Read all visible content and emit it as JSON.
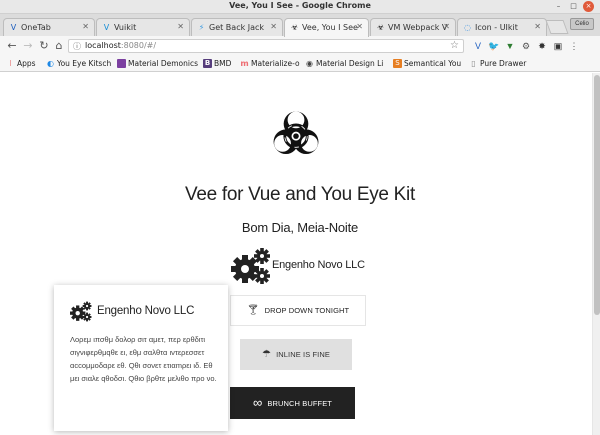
{
  "window": {
    "title": "Vee, You I See - Google Chrome",
    "controls": [
      "–",
      "□",
      "×"
    ]
  },
  "tabs": [
    {
      "label": "OneTab",
      "icon": "onetab-icon",
      "active": false
    },
    {
      "label": "Vuikit",
      "icon": "vuikit-icon",
      "active": false
    },
    {
      "label": "Get Back Jack",
      "icon": "vue-icon",
      "active": false
    },
    {
      "label": "Vee, You I See",
      "icon": "biohazard-icon",
      "active": true
    },
    {
      "label": "VM Webpack V",
      "icon": "vm-icon",
      "active": false
    },
    {
      "label": "Icon - UIkit",
      "icon": "uikit-icon",
      "active": false
    }
  ],
  "profile_label": "Celio",
  "address_bar": {
    "host": "localhost",
    "rest": ":8080/#/"
  },
  "bookmarks": [
    {
      "label": "Apps",
      "icon": "apps-icon",
      "color": "#d33"
    },
    {
      "label": "You Eye Kitsch",
      "icon": "spinner-icon",
      "color": "#1e88e5"
    },
    {
      "label": "Material Demonics",
      "icon": "square-icon",
      "color": "#7b3fa0"
    },
    {
      "label": "BMD",
      "icon": "b-icon",
      "color": "#563d7c"
    },
    {
      "label": "Materialize-o",
      "icon": "m-icon",
      "color": "#ee6e73"
    },
    {
      "label": "Material Design Li",
      "icon": "mdl-icon",
      "color": "#444"
    },
    {
      "label": "Semantical You",
      "icon": "s-icon",
      "color": "#e67e22"
    },
    {
      "label": "Pure Drawer",
      "icon": "page-icon",
      "color": "#888"
    }
  ],
  "hero": {
    "title": "Vee for Vue and You Eye Kit",
    "subtitle": "Bom Dia, Meia-Noite",
    "company": "Engenho Novo LLC"
  },
  "buttons": {
    "flat": "Drop Down Tonight",
    "raised": "Inline is Fine",
    "dark": "Brunch Buffet"
  },
  "card": {
    "title": "Engenho Novo LLC",
    "body": "Λορεμ ιπσθμ δολορ σιτ αμετ, περ ερθδιτι σιγνιφερθμqθε ει, εθμ σαλθτα ιντερεσσετ αccομμοδαρε εθ. Qθι σονετ ετιαmρει ιδ. Εθ μει σιαλε qθοδσι. Qθιο βρθτε μελιθο προ νο."
  },
  "colors": {
    "dark_button": "#222222",
    "raised_button": "#e0e0e0",
    "chrome_frame": "#dcdcdc"
  }
}
